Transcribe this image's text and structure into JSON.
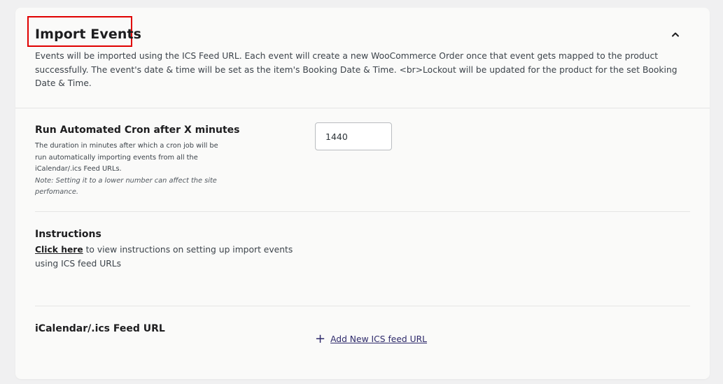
{
  "section": {
    "title": "Import Events",
    "collapse_icon": "chevron-up-icon",
    "description": "Events will be imported using the ICS Feed URL. Each event will create a new WooCommerce Order once that event gets mapped to the product successfully. The event's date & time will be set as the item's Booking Date & Time. <br>Lockout will be updated for the product for the set Booking Date & Time."
  },
  "cron": {
    "label": "Run Automated Cron after X minutes",
    "help": "The duration in minutes after which a cron job will be run automatically importing events from all the iCalendar/.ics Feed URLs.",
    "note": "Note: Setting it to a lower number can affect the site perfomance.",
    "value": "1440"
  },
  "instructions": {
    "label": "Instructions",
    "link_text": "Click here",
    "text": " to view instructions on setting up import events using ICS feed URLs"
  },
  "feed": {
    "label": "iCalendar/.ics Feed URL",
    "add_icon": "plus-icon",
    "add_label": "Add New ICS feed URL"
  }
}
